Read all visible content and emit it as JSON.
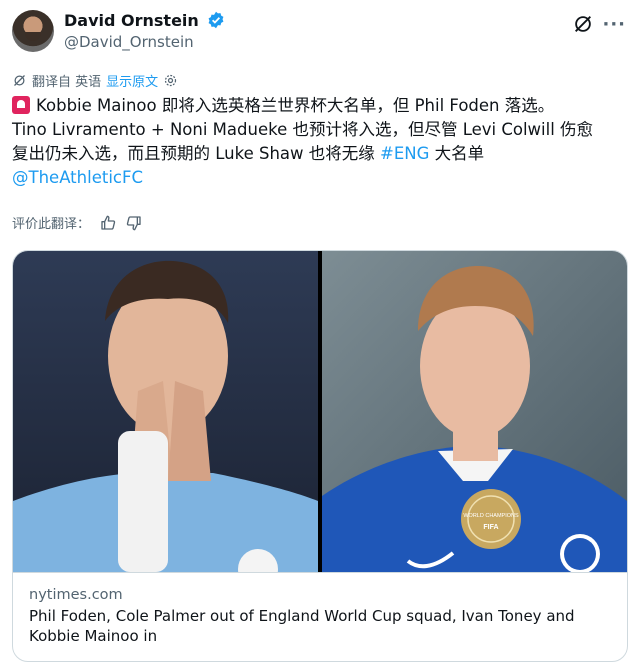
{
  "author": {
    "name": "David Ornstein",
    "handle": "@David_Ornstein"
  },
  "translate": {
    "label": "翻译自 英语",
    "show_original": "显示原文"
  },
  "tweet": {
    "line1_text": "Kobbie Mainoo 即将入选英格兰世界杯大名单，但 Phil Foden 落选。",
    "line2": "Tino Livramento + Noni Madueke 也预计将入选，但尽管 Levi Colwill 伤愈",
    "line3_before": "复出仍未入选，而且预期的 Luke Shaw 也将无缘 ",
    "line3_hashtag": "#ENG",
    "line3_after": " 大名单",
    "mention": "@TheAthleticFC"
  },
  "rate": {
    "label": "评价此翻译："
  },
  "card": {
    "domain": "nytimes.com",
    "title": "Phil Foden, Cole Palmer out of England World Cup squad, Ivan Toney and Kobbie Mainoo in",
    "badge_text": "WORLD CHAMPIONS",
    "badge_sub": "FIFA"
  },
  "colors": {
    "link": "#1d9bf0",
    "secondary_text": "#536471",
    "verified": "#1d9bf0"
  }
}
